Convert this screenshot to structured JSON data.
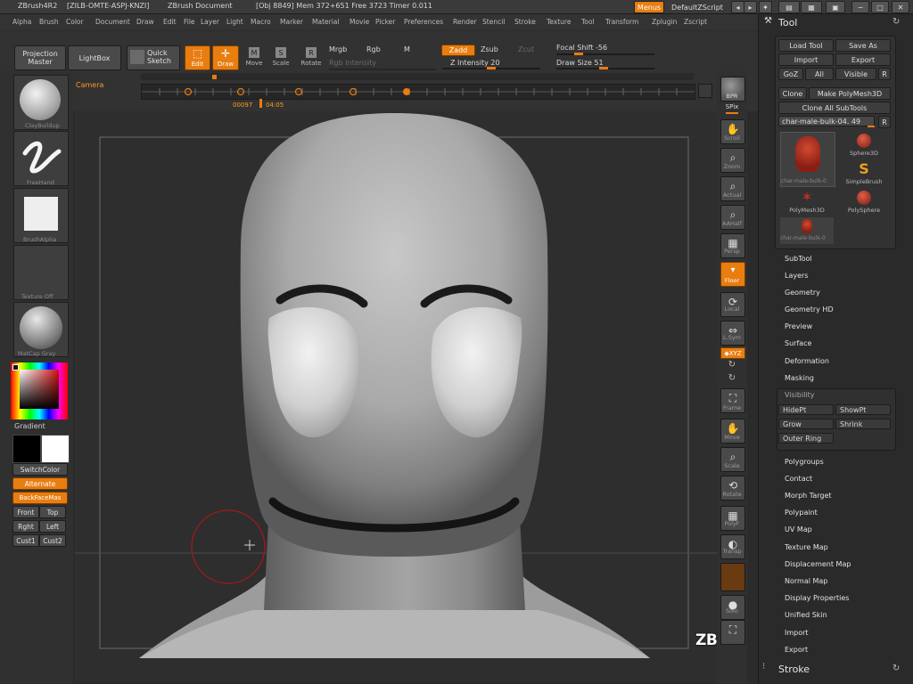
{
  "colors": {
    "accent": "#e87d10",
    "panel": "#2a2a2a",
    "canvas": "#2e2e2e",
    "brush_ring": "#a81818"
  },
  "titlebar": {
    "app": "ZBrush4R2",
    "serial": "[ZILB-OMTE-ASPJ-KNZI]",
    "document": "ZBrush Document",
    "stats": "[Obj 8849] Mem 372+651 Free 3723 Timer 0.011",
    "menus_btn": "Menus",
    "script_btn": "DefaultZScript"
  },
  "menubar": [
    "Alpha",
    "Brush",
    "Color",
    "Document",
    "Draw",
    "Edit",
    "File",
    "Layer",
    "Light",
    "Macro",
    "Marker",
    "Material",
    "Movie",
    "Picker",
    "Preferences",
    "Render",
    "Stencil",
    "Stroke",
    "Texture",
    "Tool",
    "Transform",
    "Zplugin",
    "Zscript"
  ],
  "shelf": {
    "projection_master": "Projection Master",
    "lightbox": "LightBox",
    "quick_sketch": "Quick Sketch",
    "edit": "Edit",
    "draw": "Draw",
    "move": "Move",
    "scale": "Scale",
    "rotate": "Rotate",
    "mrgb": "Mrgb",
    "rgb": "Rgb",
    "m": "M",
    "rgb_intensity": "Rgb Intensity",
    "zadd": "Zadd",
    "zsub": "Zsub",
    "zcut": "Zcut",
    "z_intensity": "Z Intensity 20",
    "focal_shift": "Focal Shift -56",
    "draw_size": "Draw Size 51",
    "camera": "Camera",
    "timeline_time": "00097",
    "timeline_time2": "04:05"
  },
  "left": {
    "brush": "ClayBuildup",
    "stroke": "FreeHand",
    "alpha": "BrushAlpha",
    "texture": "Texture Off",
    "material": "MatCap Gray",
    "gradient": "Gradient",
    "switchcolor": "SwitchColor",
    "alternate": "Alternate",
    "backface": "BackFaceMas",
    "front": "Front",
    "top": "Top",
    "right": "Rght",
    "left": "Left",
    "cust1": "Cust1",
    "cust2": "Cust2"
  },
  "right": {
    "bpr": "BPR",
    "spix": "SPix",
    "scroll": "Scroll",
    "zoom": "Zoom",
    "actual": "Actual",
    "aahalf": "AAHalf",
    "persp": "Persp",
    "floor": "Floor",
    "local": "Local",
    "lsym": "L.Sym",
    "xyz": "◆XYZ",
    "frame": "Frame",
    "move": "Move",
    "scale": "Scale",
    "rotate": "Rotate",
    "polyf": "PolyF",
    "transp": "Transp",
    "solo": "Solo"
  },
  "tool": {
    "title": "Tool",
    "load": "Load Tool",
    "saveas": "Save As",
    "import": "Import",
    "export": "Export",
    "goz": "GoZ",
    "all": "All",
    "visible": "Visible",
    "r": "R",
    "clone": "Clone",
    "make_polymesh": "Make PolyMesh3D",
    "clone_all": "Clone All SubTools",
    "current": "char-male-bulk-04. 49",
    "thumbs": [
      {
        "label": "char-male-bulk-0"
      },
      {
        "label": "Sphere3D"
      },
      {
        "label": "SimpleBrush"
      },
      {
        "label": "PolyMesh3D"
      },
      {
        "label": "PolySphere"
      },
      {
        "label": "char-male-bulk-0"
      }
    ],
    "sections": [
      "SubTool",
      "Layers",
      "Geometry",
      "Geometry HD",
      "Preview",
      "Surface",
      "Deformation",
      "Masking"
    ],
    "visibility": "Visibility",
    "hidept": "HidePt",
    "showpt": "ShowPt",
    "grow": "Grow",
    "shrink": "Shrink",
    "outer_ring": "Outer Ring",
    "sections2": [
      "Polygroups",
      "Contact",
      "Morph Target",
      "Polypaint",
      "UV Map",
      "Texture Map",
      "Displacement Map",
      "Normal Map",
      "Display Properties",
      "Unified Skin",
      "Import",
      "Export"
    ],
    "stroke": "Stroke"
  },
  "watermark": "ZBRUSH WORKSHOPS"
}
